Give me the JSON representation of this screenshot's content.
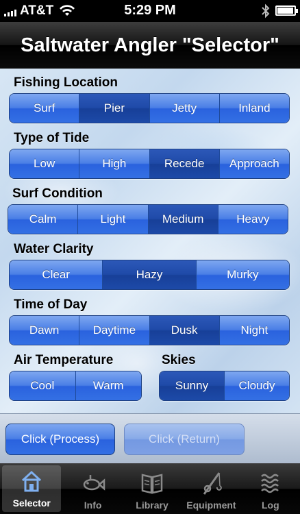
{
  "status": {
    "carrier": "AT&T",
    "time": "5:29 PM"
  },
  "nav": {
    "title": "Saltwater Angler \"Selector\""
  },
  "sections": {
    "location": {
      "label": "Fishing Location",
      "options": [
        "Surf",
        "Pier",
        "Jetty",
        "Inland"
      ],
      "selected": "Pier"
    },
    "tide": {
      "label": "Type of Tide",
      "options": [
        "Low",
        "High",
        "Recede",
        "Approach"
      ],
      "selected": "Recede"
    },
    "surf": {
      "label": "Surf Condition",
      "options": [
        "Calm",
        "Light",
        "Medium",
        "Heavy"
      ],
      "selected": "Medium"
    },
    "clarity": {
      "label": "Water Clarity",
      "options": [
        "Clear",
        "Hazy",
        "Murky"
      ],
      "selected": "Hazy"
    },
    "time": {
      "label": "Time of Day",
      "options": [
        "Dawn",
        "Daytime",
        "Dusk",
        "Night"
      ],
      "selected": "Dusk"
    },
    "temp": {
      "label": "Air Temperature",
      "options": [
        "Cool",
        "Warm"
      ],
      "selected": ""
    },
    "skies": {
      "label": "Skies",
      "options": [
        "Sunny",
        "Cloudy"
      ],
      "selected": "Sunny"
    }
  },
  "buttons": {
    "process": "Click (Process)",
    "return": "Click (Return)"
  },
  "tabs": [
    {
      "label": "Selector",
      "icon": "house-icon"
    },
    {
      "label": "Info",
      "icon": "fish-icon"
    },
    {
      "label": "Library",
      "icon": "book-icon"
    },
    {
      "label": "Equipment",
      "icon": "fishing-rod-icon"
    },
    {
      "label": "Log",
      "icon": "waves-icon"
    }
  ],
  "colors": {
    "segment": "#3a6fe2",
    "segment_selected": "#1f4aa8",
    "nav": "#000000"
  }
}
